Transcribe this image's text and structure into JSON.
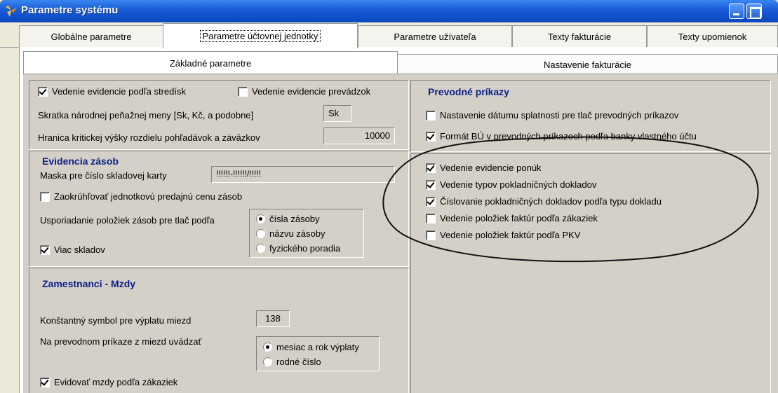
{
  "window": {
    "title": "Parametre systému"
  },
  "tabs": [
    {
      "label": "Globálne parametre"
    },
    {
      "label": "Parametre účtovnej jednotky"
    },
    {
      "label": "Parametre užívateľa"
    },
    {
      "label": "Texty fakturácie"
    },
    {
      "label": "Texty upomienok"
    }
  ],
  "subtabs": [
    {
      "label": "Základné parametre"
    },
    {
      "label": "Nastavenie fakturácie"
    }
  ],
  "general": {
    "strediska": {
      "label": "Vedenie evidencie podľa stredísk",
      "checked": true
    },
    "prevadzky": {
      "label": "Vedenie evidencie prevádzok",
      "checked": false
    },
    "currency_label": "Skratka národnej peňažnej meny [Sk, Kč, a podobne]",
    "currency_value": "Sk",
    "limit_label": "Hranica kritickej výšky rozdielu pohľadávok a záväzkov",
    "limit_value": "10000"
  },
  "inventory": {
    "heading": "Evidencia zásob",
    "mask_label": "Maska pre číslo skladovej karty",
    "mask_value": "!!!!!!-!!!!!!/!!!!!",
    "round": {
      "label": "Zaokrúhľovať jednotkovú predajnú cenu zásob",
      "checked": false
    },
    "order_label": "Usporiadanie položiek zásob pre tlač podľa",
    "order_options": [
      {
        "label": "čísla zásoby",
        "selected": true
      },
      {
        "label": "názvu zásoby",
        "selected": false
      },
      {
        "label": "fyzického poradia",
        "selected": false
      }
    ],
    "multi": {
      "label": "Viac skladov",
      "checked": true
    }
  },
  "payroll": {
    "heading": "Zamestnanci - Mzdy",
    "symbol_label": "Konštantný symbol pre výplatu miezd",
    "symbol_value": "138",
    "order_label": "Na prevodnom príkaze z miezd uvádzať",
    "options": [
      {
        "label": "mesiac a rok výplaty",
        "selected": true
      },
      {
        "label": "rodné číslo",
        "selected": false
      }
    ],
    "by_order": {
      "label": "Evidovať mzdy podľa zákaziek",
      "checked": true
    }
  },
  "transfers": {
    "heading": "Prevodné príkazy",
    "due_date": {
      "label": "Nastavenie dátumu splatnosti pre tlač prevodných príkazov",
      "checked": false
    },
    "format": {
      "label": "Formát BÚ v prevodných príkazoch podľa banky vlastného účtu",
      "checked": true
    }
  },
  "other": [
    {
      "label": "Vedenie evidencie ponúk",
      "checked": true
    },
    {
      "label": "Vedenie typov pokladničných dokladov",
      "checked": true
    },
    {
      "label": "Číslovanie pokladničných dokladov podľa typu dokladu",
      "checked": true
    },
    {
      "label": "Vedenie položiek faktúr podľa zákaziek",
      "checked": false
    },
    {
      "label": "Vedenie položiek faktúr podľa PKV",
      "checked": false
    }
  ]
}
